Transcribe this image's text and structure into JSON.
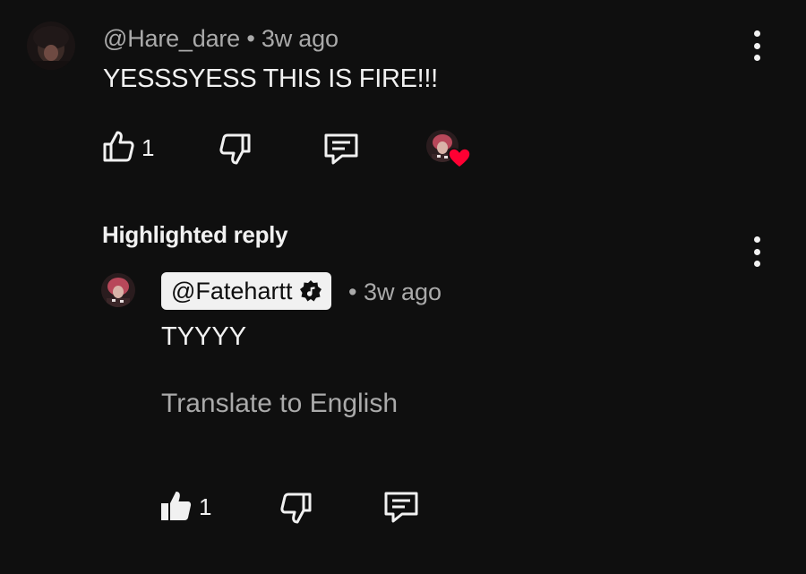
{
  "comment": {
    "author": "@Hare_dare",
    "separator": "•",
    "time": "3w ago",
    "text": "YESSSYESS THIS IS FIRE!!!",
    "likes": "1"
  },
  "highlighted_reply": {
    "label": "Highlighted reply",
    "author": "@Fatehartt",
    "separator": "•",
    "time": "3w ago",
    "text": "TYYYY",
    "translate_label": "Translate to English",
    "likes": "1"
  },
  "icons": {
    "like": "thumbs-up-icon",
    "dislike": "thumbs-down-icon",
    "reply": "reply-comment-icon",
    "more": "more-vertical-icon",
    "creator_heart": "heart-icon",
    "verified": "music-note-badge-icon"
  },
  "colors": {
    "background": "#0f0f0f",
    "primary_text": "#f1f1f1",
    "secondary_text": "#aaaaaa",
    "heart": "#ff0033"
  }
}
